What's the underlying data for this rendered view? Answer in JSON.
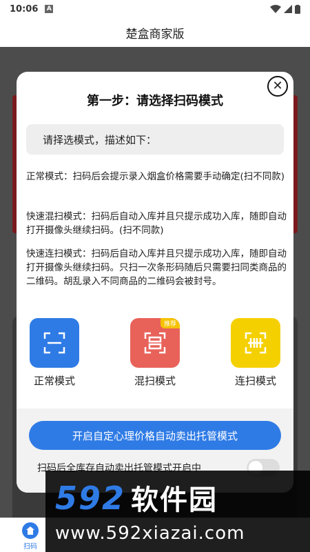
{
  "status_bar": {
    "time": "10:06"
  },
  "app": {
    "title": "楚盒商家版"
  },
  "dialog": {
    "title": "第一步：请选择扫码模式",
    "desc_header": "请择选模式，描述如下：",
    "modes_desc": [
      "正常模式：扫码后会提示录入烟盒价格需要手动确定(扫不同款)",
      "快速混扫模式：扫码后自动入库并且只提示成功入库，随即自动打开摄像头继续扫码。(扫不同款)",
      "快速连扫模式：扫码后自动入库并且只提示成功入库，随即自动打开摄像头继续扫码。只扫一次条形码随后只需要扫同类商品的二维码。胡乱录入不同商品的二维码会被封号。"
    ],
    "modes": [
      {
        "label": "正常模式",
        "color": "#2f7be6"
      },
      {
        "label": "混扫模式",
        "color": "#e8625a",
        "badge": "推荐"
      },
      {
        "label": "连扫模式",
        "color": "#f5d000"
      }
    ],
    "primary_button": "开启自定心理价格自动卖出托管模式",
    "toggle_label": "扫码后全库存自动卖出托管模式开启中"
  },
  "bottom_nav": {
    "items": [
      {
        "label": "扫码"
      }
    ]
  },
  "watermark": {
    "brand": "592",
    "brand_cn": "软件园",
    "url": "www.592xiazai.com"
  }
}
